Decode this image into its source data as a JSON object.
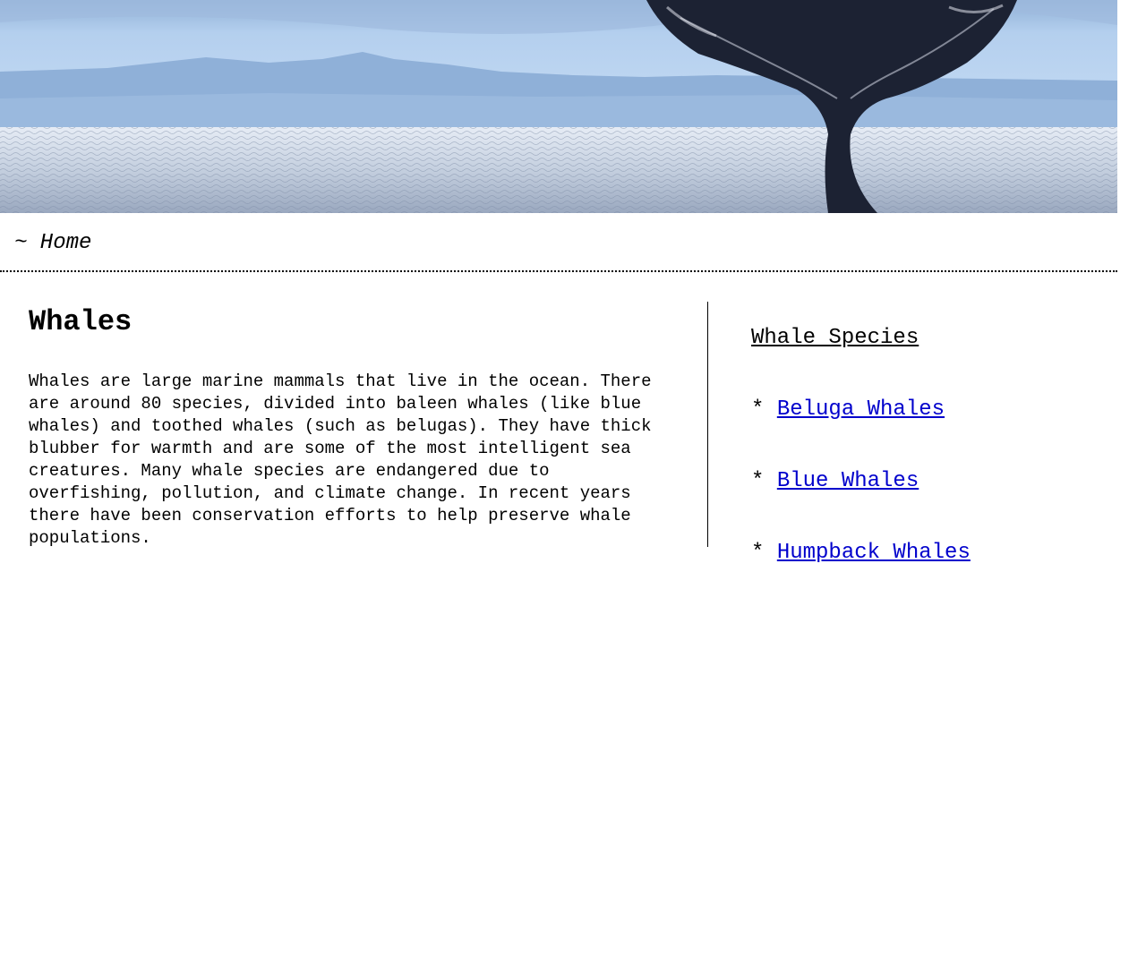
{
  "banner": {
    "alt": "Whale tail above the ocean"
  },
  "nav": {
    "home_label": "~ Home"
  },
  "main": {
    "title": "Whales",
    "body": "Whales are large marine mammals that live in the ocean. There are around 80 species, divided into baleen whales (like blue whales) and toothed whales (such as belugas). They have thick blubber for warmth and are some of the most intelligent sea creatures. Many whale species are endangered due to overfishing, pollution, and climate change. In recent years there have been conservation efforts to help preserve whale populations."
  },
  "aside": {
    "title": "Whale Species",
    "bullet": "* ",
    "items": [
      {
        "label": "Beluga Whales"
      },
      {
        "label": "Blue Whales"
      },
      {
        "label": "Humpback Whales"
      }
    ]
  },
  "colors": {
    "link": "#0000cc",
    "sky": "#b9d3ee",
    "sea": "#cfd8e6"
  }
}
